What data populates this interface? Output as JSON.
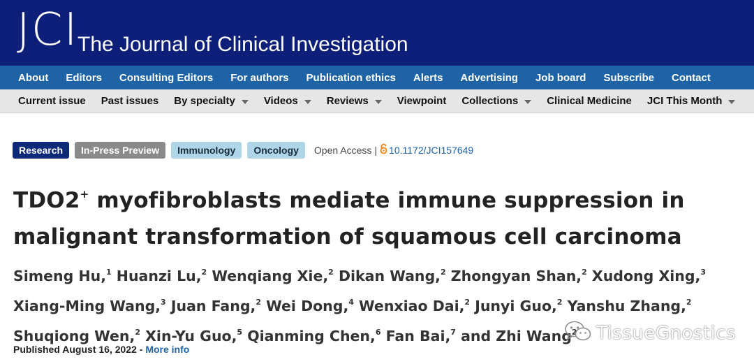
{
  "masthead": {
    "logo": "JCI",
    "journal_name": "The Journal of Clinical Investigation"
  },
  "nav_primary": [
    "About",
    "Editors",
    "Consulting Editors",
    "For authors",
    "Publication ethics",
    "Alerts",
    "Advertising",
    "Job board",
    "Subscribe",
    "Contact"
  ],
  "nav_secondary": [
    {
      "label": "Current issue",
      "dropdown": false
    },
    {
      "label": "Past issues",
      "dropdown": false
    },
    {
      "label": "By specialty",
      "dropdown": true
    },
    {
      "label": "Videos",
      "dropdown": true
    },
    {
      "label": "Reviews",
      "dropdown": true
    },
    {
      "label": "Viewpoint",
      "dropdown": false
    },
    {
      "label": "Collections",
      "dropdown": true
    },
    {
      "label": "Clinical Medicine",
      "dropdown": false
    },
    {
      "label": "JCI This Month",
      "dropdown": true
    }
  ],
  "article": {
    "tags": [
      "Research",
      "In-Press Preview",
      "Immunology",
      "Oncology"
    ],
    "open_access": "Open Access",
    "separator": "|",
    "doi": "10.1172/JCI157649",
    "title_part1": "TDO2",
    "title_sup": "+",
    "title_part2": " myofibroblasts mediate immune suppression in malignant transformation of squamous cell carcinoma",
    "authors": [
      {
        "name": "Simeng Hu,",
        "aff": "1"
      },
      {
        "name": "Huanzi Lu,",
        "aff": "2"
      },
      {
        "name": "Wenqiang Xie,",
        "aff": "2"
      },
      {
        "name": "Dikan Wang,",
        "aff": "2"
      },
      {
        "name": "Zhongyan Shan,",
        "aff": "2"
      },
      {
        "name": "Xudong Xing,",
        "aff": "3"
      },
      {
        "name": "Xiang-Ming Wang,",
        "aff": "3"
      },
      {
        "name": "Juan Fang,",
        "aff": "2"
      },
      {
        "name": "Wei Dong,",
        "aff": "4"
      },
      {
        "name": "Wenxiao Dai,",
        "aff": "2"
      },
      {
        "name": "Junyi Guo,",
        "aff": "2"
      },
      {
        "name": "Yanshu Zhang,",
        "aff": "2"
      },
      {
        "name": "Shuqiong Wen,",
        "aff": "2"
      },
      {
        "name": "Xin-Yu Guo,",
        "aff": "5"
      },
      {
        "name": "Qianming Chen,",
        "aff": "6"
      },
      {
        "name": "Fan Bai,",
        "aff": "7"
      },
      {
        "name": "and Zhi Wang",
        "aff": "2"
      }
    ],
    "published": "Published August 16, 2022 -",
    "more_info": "More info"
  },
  "watermark": {
    "text": "TissueGnostics",
    "icon": "wechat-icon"
  },
  "colors": {
    "masthead": "#0d1f78",
    "nav_primary": "#1d63a6",
    "nav_secondary": "#e6e6e6",
    "tag_research": "#0d2a7a",
    "tag_inpress": "#8a8a8a",
    "tag_subject": "#aed5e8",
    "link": "#1d63a6",
    "open_access_icon": "#f68212"
  }
}
